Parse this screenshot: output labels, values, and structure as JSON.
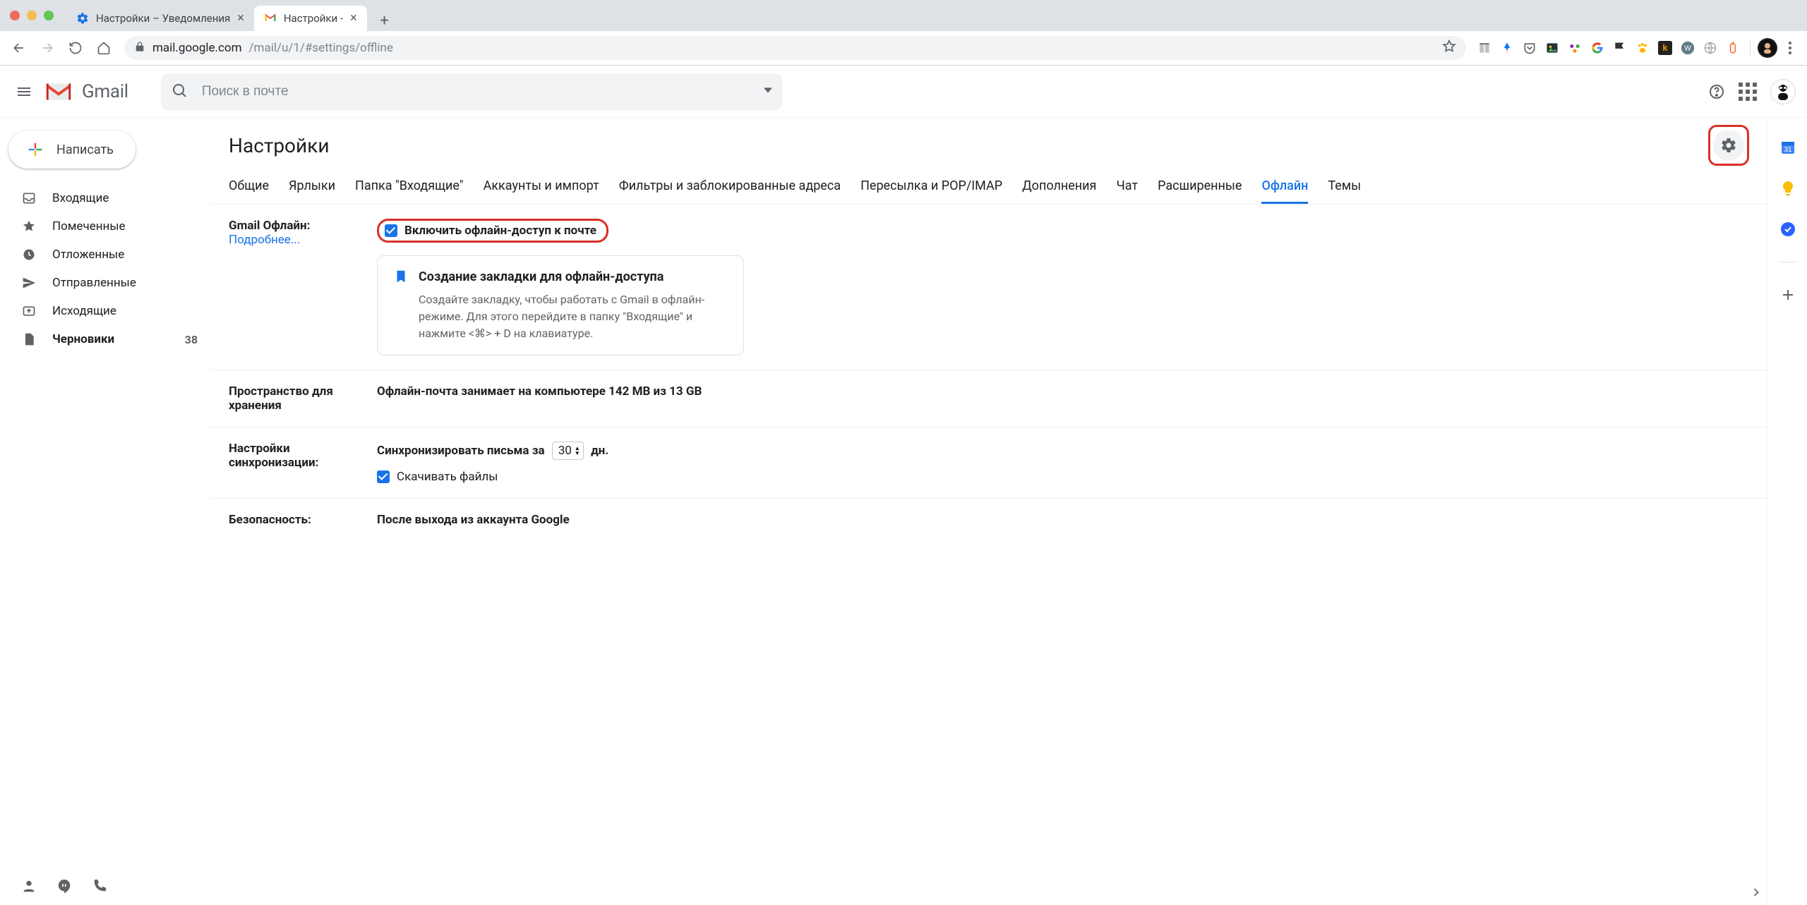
{
  "chrome": {
    "tabs": [
      {
        "title": "Настройки – Уведомления",
        "favicon_color": "#1a73e8"
      },
      {
        "title": "Настройки -",
        "favicon": "gmail"
      }
    ],
    "url_host": "mail.google.com",
    "url_path": "/mail/u/1/#settings/offline"
  },
  "gmail": {
    "logo_text": "Gmail",
    "search_placeholder": "Поиск в почте",
    "compose": "Написать",
    "folders": [
      {
        "icon": "inbox",
        "label": "Входящие",
        "count": ""
      },
      {
        "icon": "star",
        "label": "Помеченные",
        "count": ""
      },
      {
        "icon": "clock",
        "label": "Отложенные",
        "count": ""
      },
      {
        "icon": "send",
        "label": "Отправленные",
        "count": ""
      },
      {
        "icon": "outbox",
        "label": "Исходящие",
        "count": ""
      },
      {
        "icon": "draft",
        "label": "Черновики",
        "count": "38",
        "bold": true
      }
    ]
  },
  "settings": {
    "heading": "Настройки",
    "tabs": [
      "Общие",
      "Ярлыки",
      "Папка \"Входящие\"",
      "Аккаунты и импорт",
      "Фильтры и заблокированные адреса",
      "Пересылка и POP/IMAP",
      "Дополнения",
      "Чат",
      "Расширенные",
      "Офлайн",
      "Темы"
    ],
    "active_tab": "Офлайн",
    "offline": {
      "label": "Gmail Офлайн:",
      "learn_more": "Подробнее...",
      "checkbox_label": "Включить офлайн-доступ к почте",
      "tip_title": "Создание закладки для офлайн-доступа",
      "tip_body": "Создайте закладку, чтобы работать с Gmail в офлайн-режиме. Для этого перейдите в папку \"Входящие\" и нажмите <⌘> + D на клавиатуре."
    },
    "storage": {
      "label": "Пространство для хранения",
      "text": "Офлайн-почта занимает на компьютере 142 MB из 13 GB"
    },
    "sync": {
      "label": "Настройки синхронизации:",
      "text_before": "Синхронизировать письма за",
      "days": "30",
      "text_after": "дн.",
      "download_files": "Скачивать файлы"
    },
    "security": {
      "label": "Безопасность:",
      "text": "После выхода из аккаунта Google"
    }
  }
}
